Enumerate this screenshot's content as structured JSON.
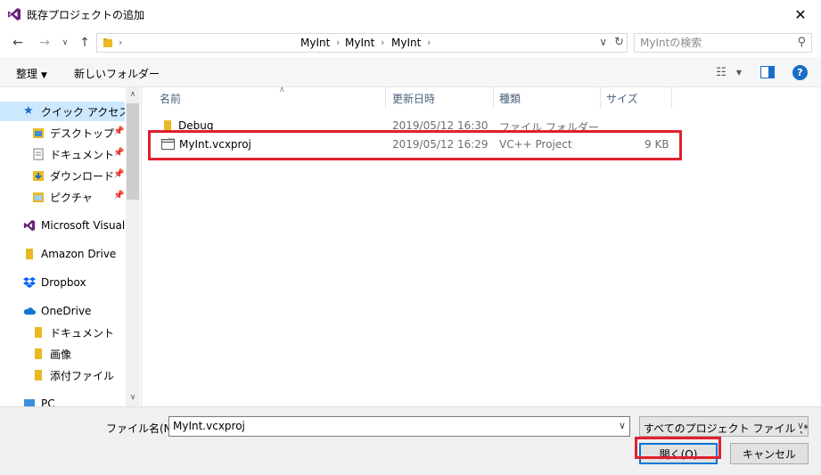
{
  "window": {
    "title": "既存プロジェクトの追加",
    "close_glyph": "✕"
  },
  "address": {
    "crumbs": [
      "MyInt",
      "MyInt",
      "MyInt"
    ],
    "search_placeholder": "MyIntの検索"
  },
  "toolbar": {
    "organize": "整理",
    "new_folder": "新しいフォルダー"
  },
  "nav": {
    "quick_access": "クイック アクセス",
    "desktop": "デスクトップ",
    "documents": "ドキュメント",
    "downloads": "ダウンロード",
    "pictures": "ピクチャ",
    "vs": "Microsoft Visual S",
    "amazon": "Amazon Drive",
    "dropbox": "Dropbox",
    "onedrive": "OneDrive",
    "od_documents": "ドキュメント",
    "od_images": "画像",
    "od_attachments": "添付ファイル",
    "pc": "PC"
  },
  "columns": {
    "name": "名前",
    "modified": "更新日時",
    "type": "種類",
    "size": "サイズ"
  },
  "files": [
    {
      "name": "Debug",
      "modified": "2019/05/12 16:30",
      "type": "ファイル フォルダー",
      "size": ""
    },
    {
      "name": "MyInt.vcxproj",
      "modified": "2019/05/12 16:29",
      "type": "VC++ Project",
      "size": "9 KB"
    }
  ],
  "footer": {
    "filename_label": "ファイル名(N):",
    "filename_value": "MyInt.vcxproj",
    "filetype": "すべてのプロジェクト ファイル (*.cspro",
    "open": "開く(O)",
    "cancel": "キャンセル"
  },
  "colors": {
    "accent": "#0078d7",
    "highlight": "#e0202e",
    "selected_bg": "#cce8ff",
    "folder": "#e8b923"
  }
}
